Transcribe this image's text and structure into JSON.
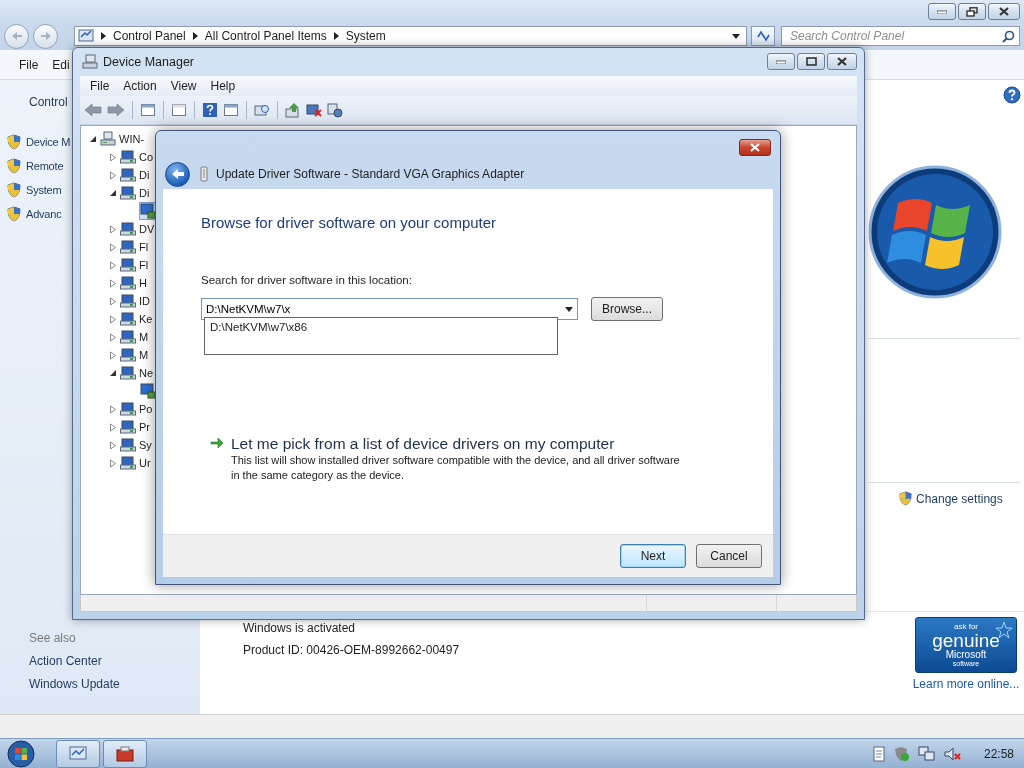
{
  "control_panel": {
    "breadcrumb": [
      "Control Panel",
      "All Control Panel Items",
      "System"
    ],
    "search": {
      "placeholder": "Search Control Panel"
    },
    "menu": [
      "File",
      "Edi"
    ],
    "sidebar": {
      "home": "Control",
      "items": [
        "Device M",
        "Remote",
        "System",
        "Advanc"
      ]
    },
    "see_also": {
      "title": "See also",
      "links": [
        "Action Center",
        "Windows Update"
      ]
    },
    "change_settings": "Change settings",
    "activation": {
      "status": "Windows is activated",
      "product_id": "Product ID:  00426-OEM-8992662-00497"
    },
    "genuine_badge": {
      "ask": "ask for",
      "genuine": "genuine",
      "brand": "Microsoft",
      "software": "software"
    },
    "learn_more": "Learn more online..."
  },
  "device_manager": {
    "title": "Device Manager",
    "menu": [
      "File",
      "Action",
      "View",
      "Help"
    ],
    "tree": [
      {
        "label": "WIN-",
        "kind": "computer",
        "expanded": true,
        "selected": false,
        "children": [
          {
            "label": "Co",
            "kind": "category",
            "expanded": false,
            "selected": false
          },
          {
            "label": "Di",
            "kind": "category",
            "expanded": false,
            "selected": false
          },
          {
            "label": "Di",
            "kind": "category",
            "expanded": true,
            "selected": false,
            "children": [
              {
                "kind": "device",
                "selected": true
              }
            ]
          },
          {
            "label": "DV",
            "kind": "category",
            "expanded": false,
            "selected": false
          },
          {
            "label": "Fl",
            "kind": "category",
            "expanded": false,
            "selected": false
          },
          {
            "label": "Fl",
            "kind": "category",
            "expanded": false,
            "selected": false
          },
          {
            "label": "H",
            "kind": "category",
            "expanded": false,
            "selected": false
          },
          {
            "label": "ID",
            "kind": "category",
            "expanded": false,
            "selected": false
          },
          {
            "label": "Ke",
            "kind": "category",
            "expanded": false,
            "selected": false
          },
          {
            "label": "M",
            "kind": "category",
            "expanded": false,
            "selected": false
          },
          {
            "label": "M",
            "kind": "category",
            "expanded": false,
            "selected": false
          },
          {
            "label": "Ne",
            "kind": "category",
            "expanded": true,
            "selected": false,
            "children": [
              {
                "kind": "device",
                "selected": false
              }
            ]
          },
          {
            "label": "Po",
            "kind": "category",
            "expanded": false,
            "selected": false
          },
          {
            "label": "Pr",
            "kind": "category",
            "expanded": false,
            "selected": false
          },
          {
            "label": "Sy",
            "kind": "category",
            "expanded": false,
            "selected": false
          },
          {
            "label": "Ur",
            "kind": "category",
            "expanded": false,
            "selected": false
          }
        ]
      }
    ]
  },
  "dialog": {
    "title": "Update Driver Software - Standard VGA Graphics Adapter",
    "heading": "Browse for driver software on your computer",
    "location_label": "Search for driver software in this location:",
    "location": {
      "value": "D:\\NetKVM\\w7\\x"
    },
    "suggestions": [
      "D:\\NetKVM\\w7\\x86"
    ],
    "browse": "Browse...",
    "option": {
      "title": "Let me pick from a list of device drivers on my computer",
      "description": "This list will show installed driver software compatible with the device, and all driver software in the same category as the device."
    },
    "buttons": [
      {
        "label": "Next",
        "default": true
      },
      {
        "label": "Cancel",
        "default": false
      }
    ]
  },
  "taskbar": {
    "clock": "22:58"
  }
}
